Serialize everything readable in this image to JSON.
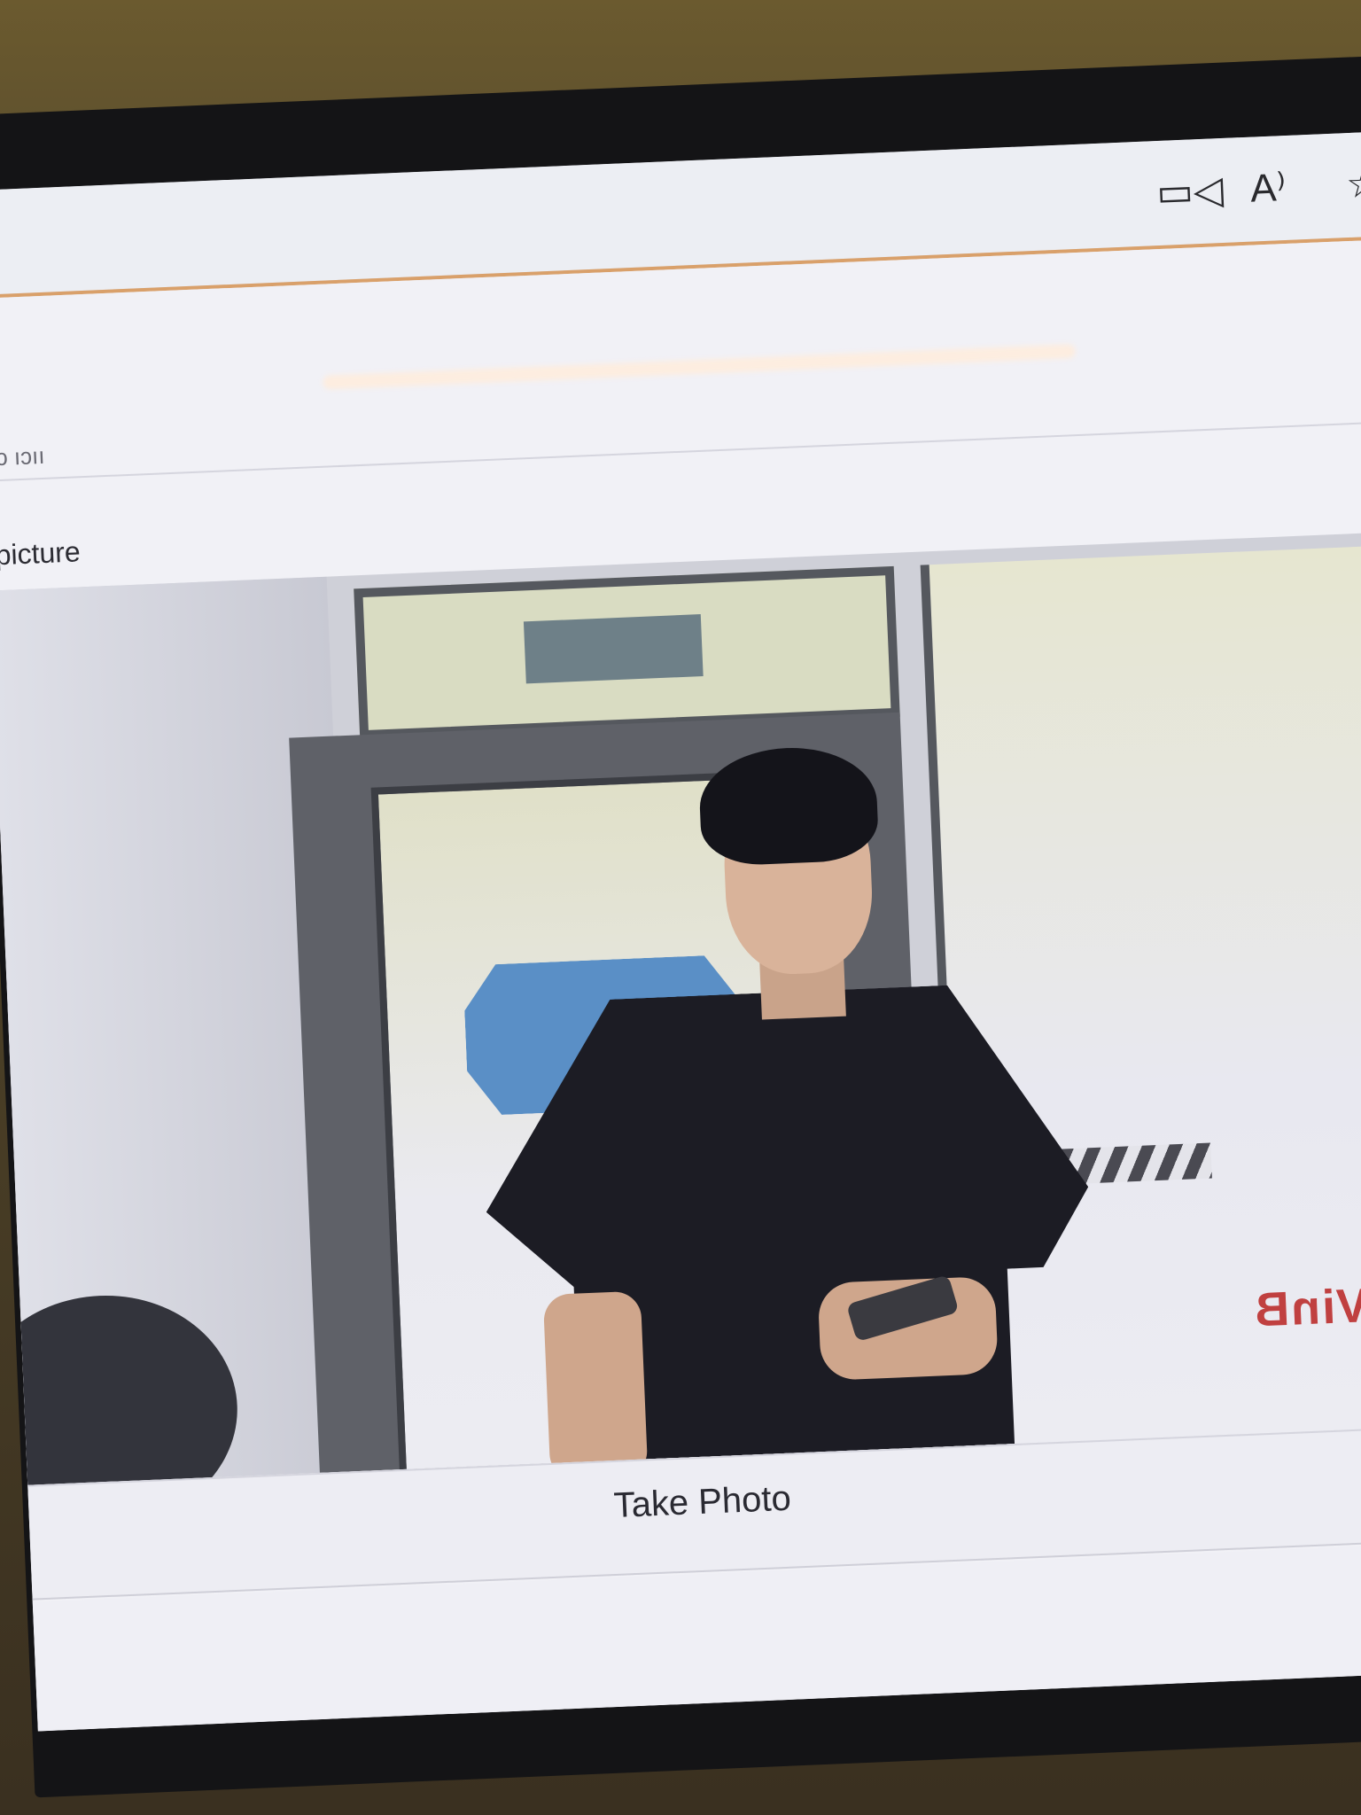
{
  "toolbar": {
    "icons": [
      "video-camera-icon",
      "read-aloud-icon",
      "favorite-star-icon"
    ],
    "camera_glyph": "▭◁",
    "read_glyph": "A⁾",
    "star_glyph": "☆"
  },
  "page": {
    "faded_text": "ɔɔ ıɔıı",
    "prompt": "ke a picture"
  },
  "camera_feed": {
    "background_logo": "VinB"
  },
  "actions": {
    "take_photo_label": "Take Photo"
  },
  "colors": {
    "accent_line": "#d9a06a",
    "page_background": "#f1f1f6",
    "text": "#2a2a32"
  }
}
